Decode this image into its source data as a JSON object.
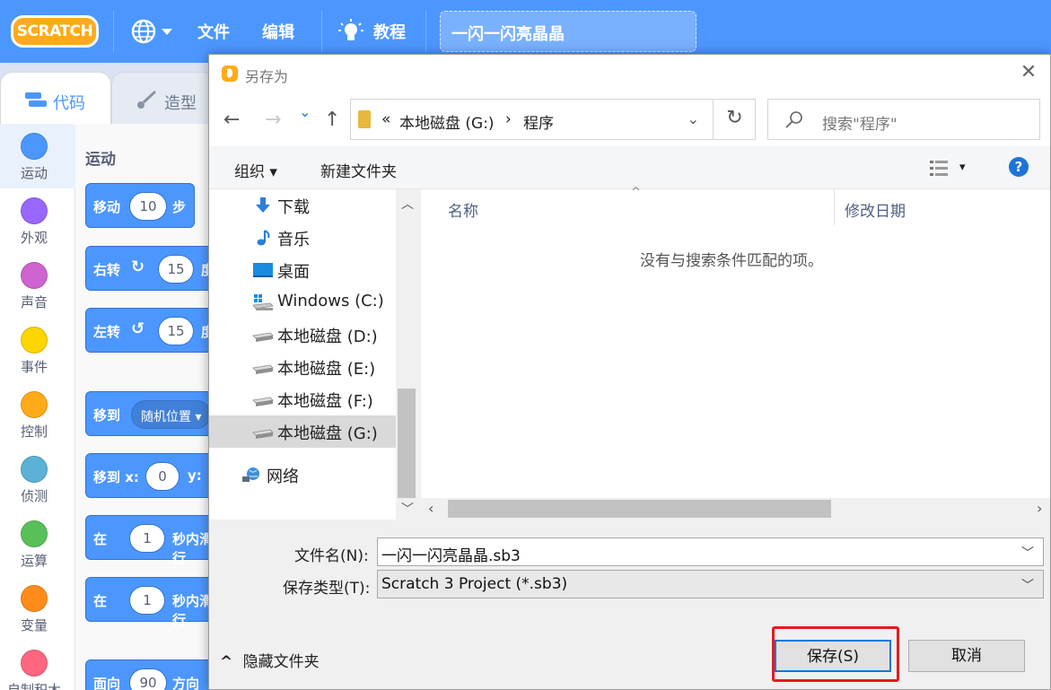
{
  "scratch": {
    "logo": "SCRATCH",
    "menu": {
      "file": "文件",
      "edit": "编辑",
      "tutorials": "教程"
    },
    "project_title": "一闪一闪亮晶晶",
    "tabs": {
      "code": "代码",
      "costumes": "造型"
    },
    "categories": [
      {
        "label": "运动",
        "color": "#4c97ff"
      },
      {
        "label": "外观",
        "color": "#9966ff"
      },
      {
        "label": "声音",
        "color": "#cf63cf"
      },
      {
        "label": "事件",
        "color": "#ffd500"
      },
      {
        "label": "控制",
        "color": "#ffab19"
      },
      {
        "label": "侦测",
        "color": "#5cb1d6"
      },
      {
        "label": "运算",
        "color": "#59c059"
      },
      {
        "label": "变量",
        "color": "#ff8c1a"
      },
      {
        "label": "自制积木",
        "color": "#ff6680"
      }
    ],
    "palette_title": "运动",
    "blocks": {
      "move": {
        "label": "移动",
        "value": "10",
        "suffix": "步"
      },
      "turn_right": {
        "label": "右转",
        "value": "15",
        "suffix": "度"
      },
      "turn_left": {
        "label": "左转",
        "value": "15",
        "suffix": "度"
      },
      "goto": {
        "label": "移到",
        "dropdown": "随机位置"
      },
      "goto_xy": {
        "label": "移到 x:",
        "x": "0",
        "y_label": "y:"
      },
      "glide1": {
        "label": "在",
        "value": "1",
        "suffix": "秒内滑行"
      },
      "glide2": {
        "label": "在",
        "value": "1",
        "suffix": "秒内滑行"
      },
      "point": {
        "label": "面向",
        "value": "90",
        "suffix": "方向"
      }
    }
  },
  "dialog": {
    "title": "另存为",
    "close": "✕",
    "nav": {
      "back": "←",
      "forward": "→",
      "recent": "⌄",
      "up": "↑",
      "refresh": "↻"
    },
    "address": {
      "prefix": "«",
      "drive": "本地磁盘 (G:)",
      "sep": "›",
      "folder": "程序",
      "chevron": "⌄"
    },
    "search_placeholder": "搜索\"程序\"",
    "toolbar": {
      "organize": "组织 ▾",
      "new_folder": "新建文件夹",
      "view_caret": "▾",
      "help": "?"
    },
    "tree": [
      {
        "label": "下载",
        "icon": "download-arrow-icon"
      },
      {
        "label": "音乐",
        "icon": "music-note-icon"
      },
      {
        "label": "桌面",
        "icon": "desktop-icon"
      },
      {
        "label": "Windows (C:)",
        "icon": "windows-drive-icon"
      },
      {
        "label": "本地磁盘 (D:)",
        "icon": "drive-icon"
      },
      {
        "label": "本地磁盘 (E:)",
        "icon": "drive-icon"
      },
      {
        "label": "本地磁盘 (F:)",
        "icon": "drive-icon"
      },
      {
        "label": "本地磁盘 (G:)",
        "icon": "drive-icon",
        "selected": true
      },
      {
        "label": "网络",
        "icon": "network-icon"
      }
    ],
    "columns": {
      "name": "名称",
      "modified": "修改日期"
    },
    "empty_message": "没有与搜索条件匹配的项。",
    "filename_label": "文件名(N):",
    "filename_value": "一闪一闪亮晶晶.sb3",
    "filetype_label": "保存类型(T):",
    "filetype_value": "Scratch 3 Project (*.sb3)",
    "hide_folders": "隐藏文件夹",
    "save": "保存(S)",
    "cancel": "取消"
  },
  "colors": {
    "scratch_blue": "#4c97ff",
    "highlight_red": "#e8191d",
    "accent_blue": "#0078d7"
  }
}
